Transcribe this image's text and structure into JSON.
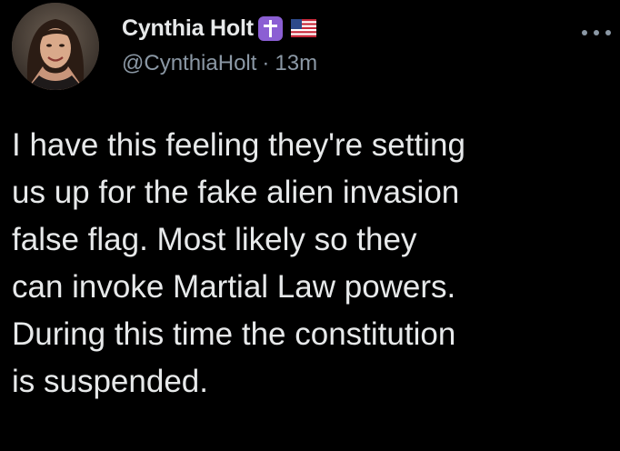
{
  "author": {
    "display_name": "Cynthia Holt",
    "handle": "@CynthiaHolt",
    "separator": "·",
    "time_ago": "13m",
    "badges": [
      "cross-icon",
      "us-flag-icon"
    ],
    "badge_color": "#8b5fd3"
  },
  "menu": {
    "icon": "more-horizontal-icon"
  },
  "tweet": {
    "lines": [
      "I have this feeling they're setting",
      "us up for the fake alien invasion",
      "false flag. Most likely so they",
      "can invoke Martial Law powers.",
      "During this time the constitution",
      "is suspended."
    ]
  },
  "theme": {
    "background": "#000000",
    "text": "#e7e9ea",
    "secondary_text": "#8b98a5"
  }
}
